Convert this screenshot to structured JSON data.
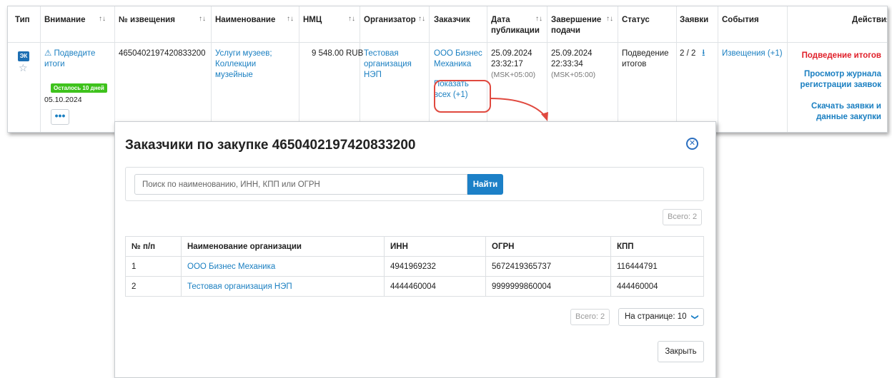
{
  "table": {
    "headers": {
      "type": "Тип",
      "attention": "Внимание",
      "notice_no": "№ извещения",
      "name": "Наименование",
      "nmc": "НМЦ",
      "organizer": "Организатор",
      "customer": "Заказчик",
      "pub_date": "Дата публикации",
      "end_date": "Завершение подачи",
      "status": "Статус",
      "bids": "Заявки",
      "events": "События",
      "actions": "Действия"
    },
    "sort_glyph": "↑↓",
    "row": {
      "type_badge": "ЭК",
      "attention_link": "Подведите итоги",
      "days_left": "Осталось 10 дней",
      "attention_date": "05.10.2024",
      "more": "•••",
      "notice_no": "4650402197420833200",
      "name": "Услуги музеев; Коллекции музейные",
      "nmc": "9 548.00 RUB",
      "organizer": "Тестовая организация НЭП",
      "customer": "ООО Бизнес Механика",
      "show_all": "Показать всех (+1)",
      "pub_date": "25.09.2024",
      "pub_time": "23:32:17",
      "pub_tz": "(MSK+05:00)",
      "end_date": "25.09.2024",
      "end_time": "22:33:34",
      "end_tz": "(MSK+05:00)",
      "status": "Подведение итогов",
      "bids": "2 / 2",
      "events": "Извещения (+1)",
      "action_summarize": "Подведение итогов",
      "action_journal": "Просмотр журнала регистрации заявок",
      "action_download": "Скачать заявки и данные закупки"
    }
  },
  "modal": {
    "title": "Заказчики по закупке 4650402197420833200",
    "search_placeholder": "Поиск по наименованию, ИНН, КПП или ОГРН",
    "search_button": "Найти",
    "total_top": "Всего: 2",
    "columns": [
      "№ п/п",
      "Наименование организации",
      "ИНН",
      "ОГРН",
      "КПП"
    ],
    "rows": [
      [
        "1",
        "ООО Бизнес Механика",
        "4941969232",
        "5672419365737",
        "116444791"
      ],
      [
        "2",
        "Тестовая организация НЭП",
        "4444460004",
        "9999999860004",
        "444460004"
      ]
    ],
    "total_bottom": "Всего: 2",
    "per_page": "На странице: 10",
    "close_button": "Закрыть"
  },
  "colors": {
    "link": "#1a7fc1",
    "primary_button": "#1c80c7",
    "action_red": "#e0202a",
    "badge_green": "#3ec21c",
    "annotation_red": "#e0493f"
  }
}
